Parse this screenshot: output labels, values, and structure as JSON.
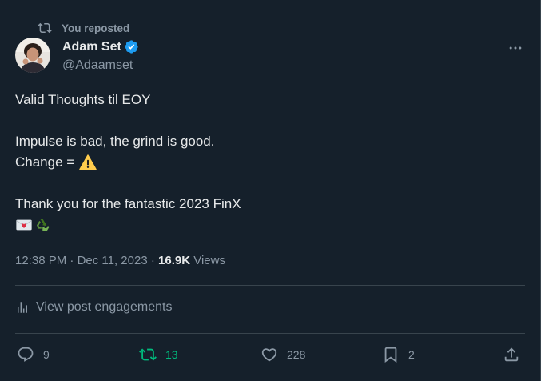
{
  "repost": {
    "label": "You reposted"
  },
  "author": {
    "name": "Adam Set",
    "handle": "@Adaamset",
    "verified": true
  },
  "post": {
    "lines": [
      {
        "text": "Valid Thoughts til EOY",
        "emoji": ""
      },
      {
        "text": "",
        "emoji": ""
      },
      {
        "text": "Impulse is bad, the grind is good.",
        "emoji": ""
      },
      {
        "text": "Change =",
        "emoji": "warning"
      },
      {
        "text": "",
        "emoji": ""
      },
      {
        "text": "Thank you for the fantastic 2023 FinX",
        "emoji": ""
      },
      {
        "text": "",
        "emoji": "love-letter, recycle"
      }
    ]
  },
  "meta": {
    "time": "12:38 PM",
    "sep1": " · ",
    "date": "Dec 11, 2023",
    "sep2": " · ",
    "views_count": "16.9K",
    "views_label": " Views"
  },
  "engagements": {
    "label": "View post engagements"
  },
  "actions": {
    "replies": "9",
    "reposts": "13",
    "likes": "228",
    "bookmarks": "2"
  },
  "colors": {
    "background": "#15202b",
    "text": "#e7e9ea",
    "muted": "#8b98a5",
    "divider": "#38444d",
    "verified": "#1d9bf0",
    "repost_active": "#00ba7c"
  },
  "icons": {
    "repost": "repost-icon",
    "verified": "verified-badge-icon",
    "more": "more-icon",
    "engagements": "bar-chart-icon",
    "reply": "reply-icon",
    "like": "heart-icon",
    "bookmark": "bookmark-icon",
    "share": "share-icon"
  }
}
